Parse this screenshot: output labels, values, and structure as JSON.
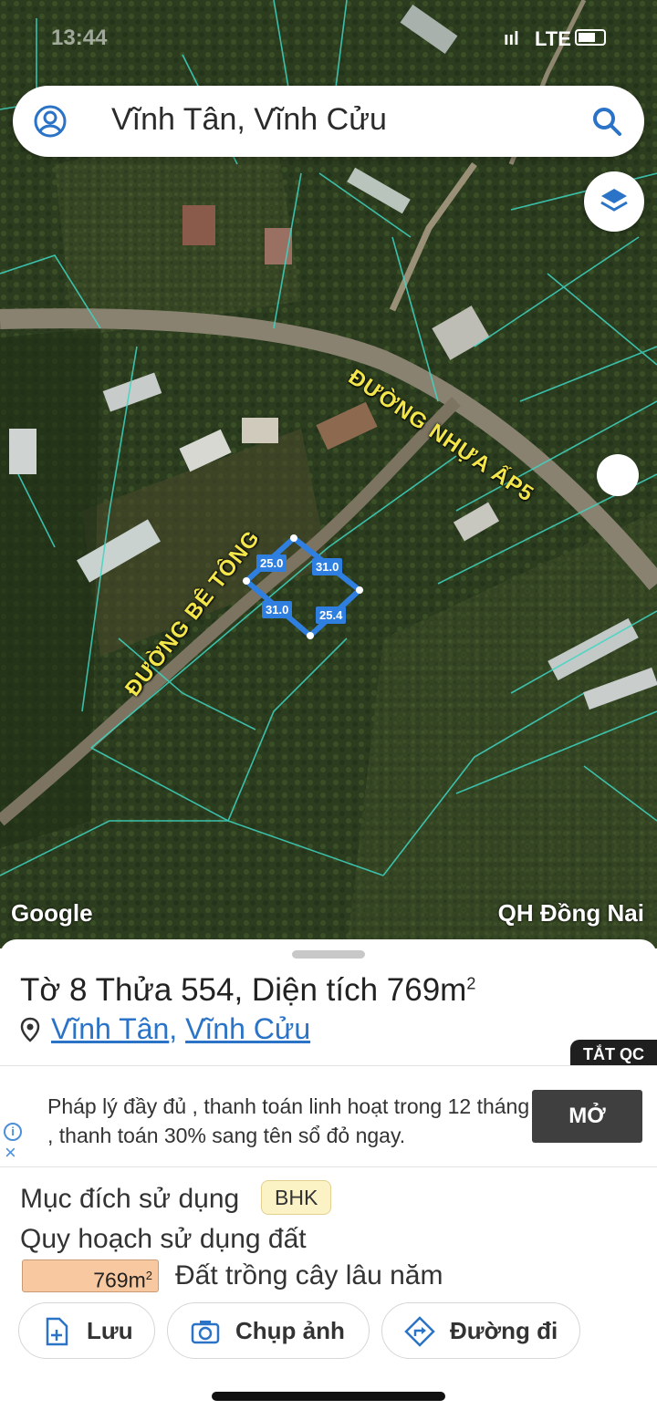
{
  "status_bar": {
    "time": "13:44",
    "signal": "ııl",
    "network": "LTE"
  },
  "search": {
    "query": "Vĩnh Tân, Vĩnh Cửu"
  },
  "map": {
    "road_labels": [
      "ĐƯỜNG NHỰA ẤP5",
      "ĐƯỜNG BÊ TÔNG"
    ],
    "dimensions": [
      "25.0",
      "31.0",
      "31.0",
      "25.4"
    ],
    "watermark": "Google",
    "layer_name": "QH Đồng Nai"
  },
  "parcel": {
    "title": "Tờ 8 Thửa 554, Diện tích 769m",
    "title_unit_sup": "2",
    "location_parts": [
      "Vĩnh Tân",
      "Vĩnh Cửu"
    ],
    "location_sep": ","
  },
  "ad": {
    "close_tag": "TẮT QC",
    "text": "Pháp lý đầy đủ , thanh toán linh hoạt trong 12 tháng , thanh toán 30% sang tên sổ đỏ ngay.",
    "button": "MỞ",
    "info_glyph": "i",
    "close_glyph": "×"
  },
  "land": {
    "purpose_label": "Mục đích sử dụng",
    "purpose_code": "BHK",
    "planning_label": "Quy hoạch sử dụng đất",
    "planning_area": "769m",
    "planning_area_sup": "2",
    "planning_desc": "Đất trồng cây lâu năm"
  },
  "actions": {
    "save": "Lưu",
    "photo": "Chụp ảnh",
    "directions": "Đường đi"
  },
  "colors": {
    "accent": "#2a73c6",
    "parcel_outline": "#2f7fe0",
    "road_label": "#f3e64a",
    "plan_fill": "#f8c8a0"
  }
}
